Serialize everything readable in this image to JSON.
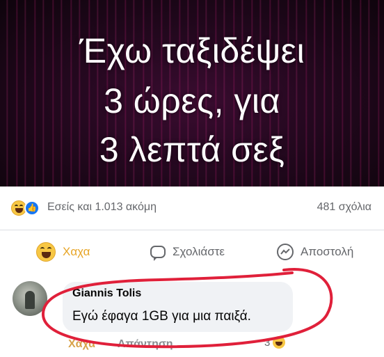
{
  "banner": {
    "line1": "Έχω ταξιδέψει",
    "line2": "3 ώρες, για",
    "line3": "3 λεπτά σεξ"
  },
  "reactions": {
    "summary": "Εσείς και 1.013 ακόμη",
    "comments_count": "481 σχόλια"
  },
  "actions": {
    "haha_label": "Χαχα",
    "comment_label": "Σχολιάστε",
    "share_label": "Αποστολή"
  },
  "comment": {
    "author": "Giannis Tolis",
    "text": "Εγώ έφαγα 1GB για μια παιξά.",
    "haha_label": "Χαχα",
    "reply_label": "Απάντηση",
    "reaction_count": "3"
  },
  "colors": {
    "haha_accent": "#e7a527",
    "like_blue": "#1877f2",
    "annotation_red": "#e0203a"
  },
  "icons": [
    "haha-reaction-icon",
    "like-reaction-icon",
    "comment-icon",
    "messenger-icon"
  ]
}
